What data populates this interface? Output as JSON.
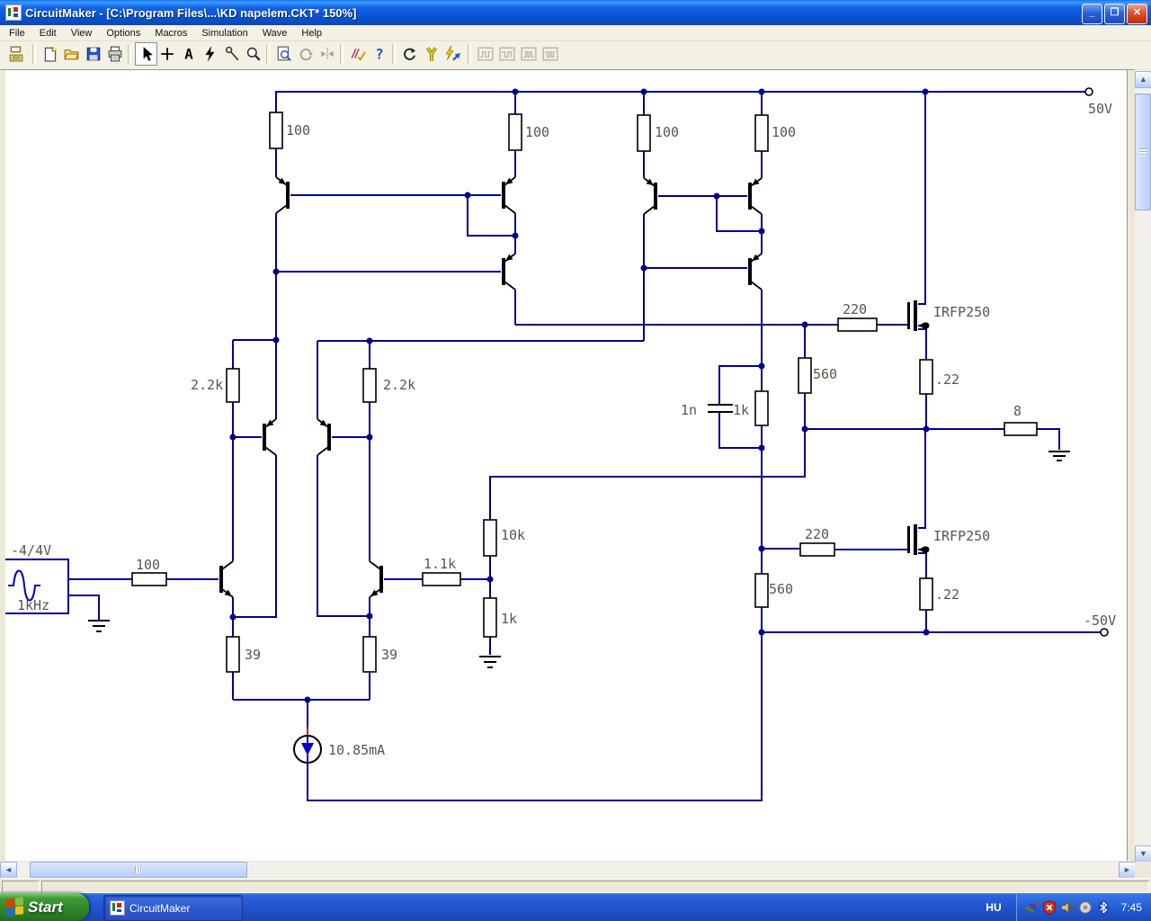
{
  "window": {
    "title": "CircuitMaker - [C:\\Program Files\\...\\KD napelem.CKT* 150%]",
    "controls": {
      "minimize": "_",
      "restore": "❐",
      "close": "✕"
    }
  },
  "menu": {
    "items": [
      "File",
      "Edit",
      "View",
      "Options",
      "Macros",
      "Simulation",
      "Wave",
      "Help"
    ]
  },
  "toolbar": {
    "tools": [
      "parts-browser",
      "new-circuit",
      "open-circuit",
      "save-circuit",
      "print",
      "arrow-tool",
      "wire-tool",
      "text-tool",
      "delete-tool",
      "naming-probe-tool",
      "zoom-tool",
      "view-area",
      "rotate",
      "mirror",
      "check-pin-connections",
      "help",
      "reset-simulation",
      "probe-tool",
      "run-trace",
      "digital-display-1",
      "digital-display-2",
      "digital-display-3",
      "digital-display-4"
    ]
  },
  "schematic": {
    "wire_color": "#00008c",
    "component_color": "#000000",
    "label_color": "#57564d",
    "labels": [
      {
        "name": "r1-value",
        "text": "100"
      },
      {
        "name": "r2-value",
        "text": "100"
      },
      {
        "name": "r3-value",
        "text": "100"
      },
      {
        "name": "r4-value",
        "text": "100"
      },
      {
        "name": "positive-supply",
        "text": "50V"
      },
      {
        "name": "r5-value",
        "text": "2.2k"
      },
      {
        "name": "r6-value",
        "text": "2.2k"
      },
      {
        "name": "input-resistor-value",
        "text": "100"
      },
      {
        "name": "source-amplitude",
        "text": "-4/4V"
      },
      {
        "name": "source-frequency",
        "text": "1kHz"
      },
      {
        "name": "r39-left-value",
        "text": "39"
      },
      {
        "name": "r39-right-value",
        "text": "39"
      },
      {
        "name": "feedback-10k-value",
        "text": "10k"
      },
      {
        "name": "feedback-1.1k-value",
        "text": "1.1k"
      },
      {
        "name": "feedback-1k-value",
        "text": "1k"
      },
      {
        "name": "current-source-value",
        "text": "10.85mA"
      },
      {
        "name": "comp-cap-value",
        "text": "1n"
      },
      {
        "name": "comp-res-value",
        "text": "1k"
      },
      {
        "name": "r560-top-value",
        "text": "560"
      },
      {
        "name": "r220-top-value",
        "text": "220"
      },
      {
        "name": "mosfet-top-part",
        "text": "IRFP250"
      },
      {
        "name": "r22-top-value",
        "text": ".22"
      },
      {
        "name": "load-value",
        "text": "8"
      },
      {
        "name": "r220-bottom-value",
        "text": "220"
      },
      {
        "name": "mosfet-bottom-part",
        "text": "IRFP250"
      },
      {
        "name": "r560-bottom-value",
        "text": "560"
      },
      {
        "name": "r22-bottom-value",
        "text": ".22"
      },
      {
        "name": "negative-supply",
        "text": "-50V"
      }
    ]
  },
  "statusbar": {
    "left": "",
    "main": ""
  },
  "taskbar": {
    "start_label": "Start",
    "tasks": [
      {
        "label": "CircuitMaker"
      }
    ],
    "language": "HU",
    "time": "7:45",
    "tray_icons": [
      "display-adapter",
      "security-alert",
      "volume",
      "audio-device",
      "bluetooth"
    ]
  }
}
